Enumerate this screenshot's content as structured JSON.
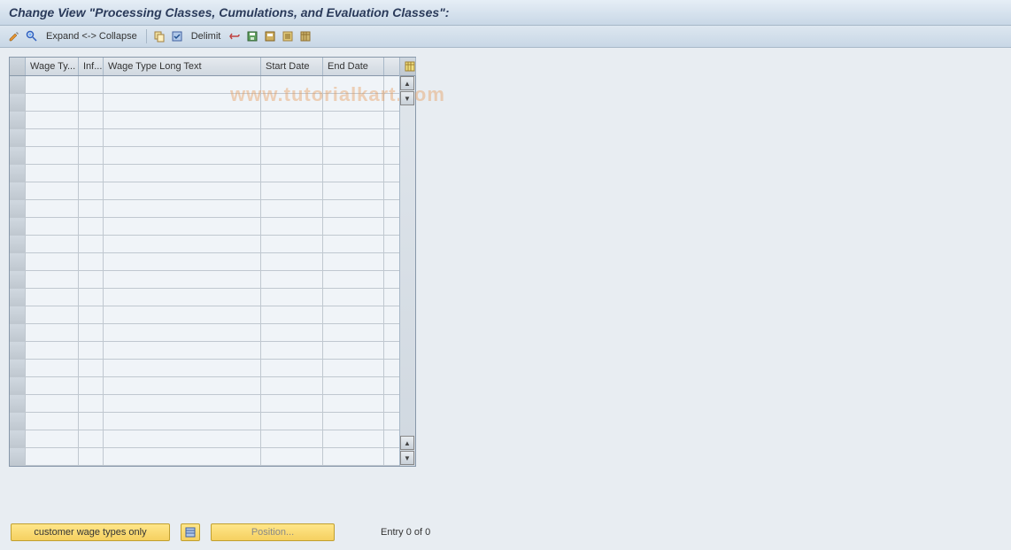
{
  "title": "Change View \"Processing Classes, Cumulations, and Evaluation Classes\":",
  "toolbar": {
    "expand_label": "Expand <-> Collapse",
    "delimit_label": "Delimit"
  },
  "table": {
    "columns": {
      "wage_type": "Wage Ty...",
      "inf": "Inf...",
      "long_text": "Wage Type Long Text",
      "start_date": "Start Date",
      "end_date": "End Date"
    },
    "rows": []
  },
  "footer": {
    "customer_btn": "customer wage types only",
    "position_btn": "Position...",
    "entry_text": "Entry 0 of 0"
  },
  "watermark": "www.tutorialkart.com"
}
